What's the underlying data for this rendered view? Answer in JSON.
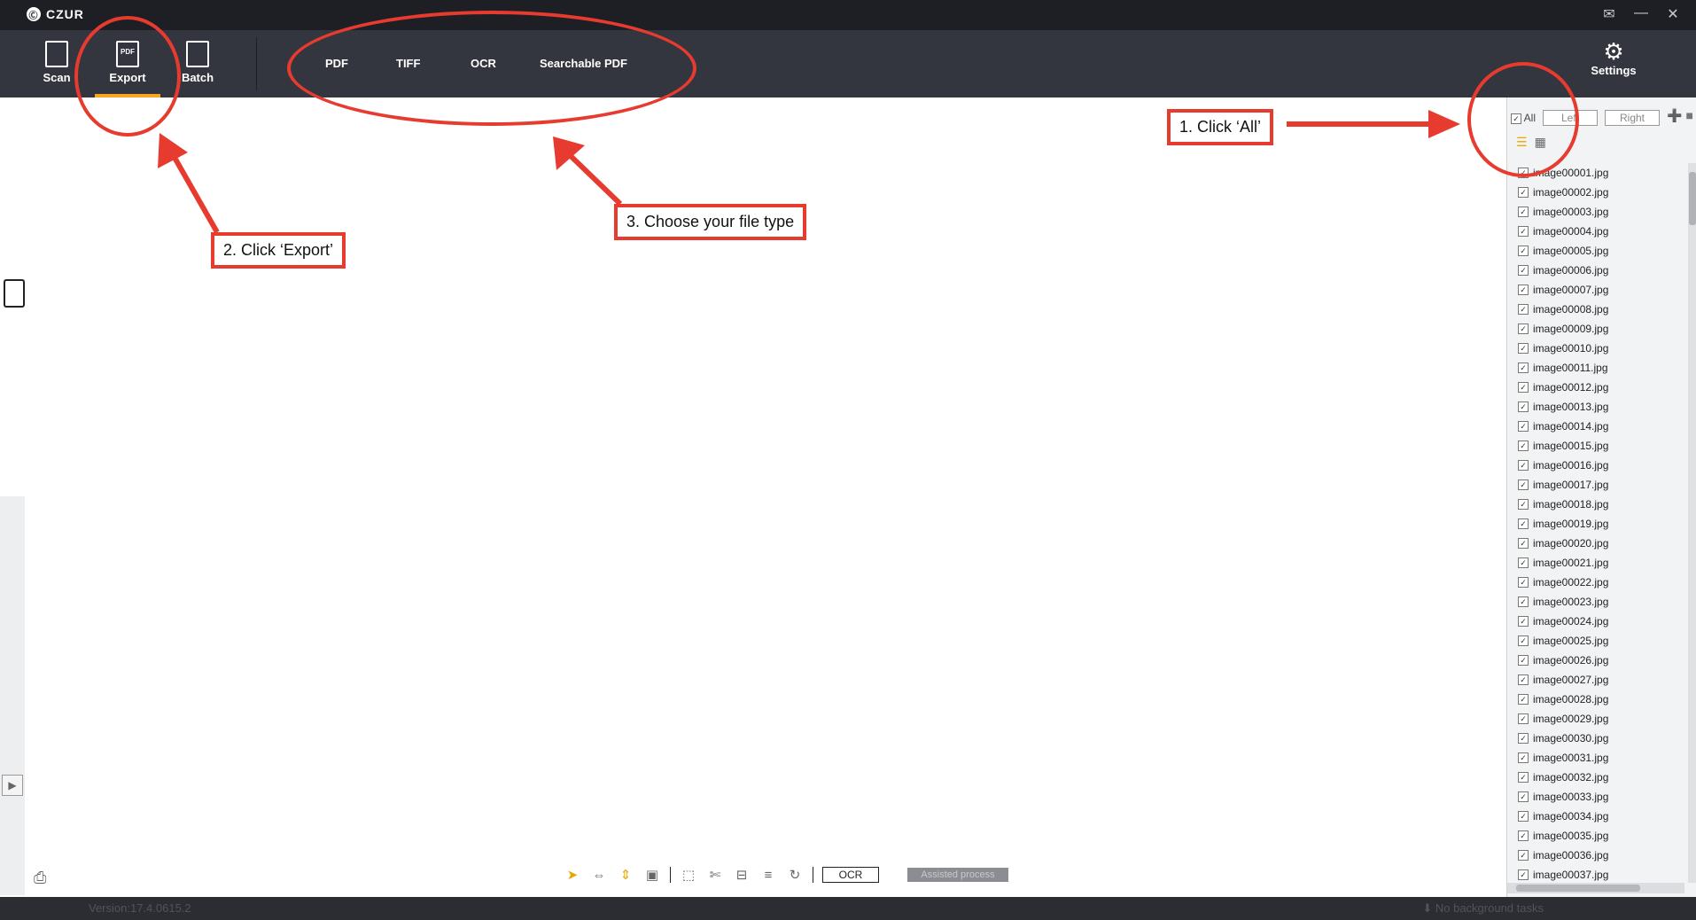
{
  "app": {
    "name": "CZUR",
    "logo_glyph": "Ⓒ"
  },
  "window_controls": {
    "mail": "✉",
    "minimize": "—",
    "close": "✕"
  },
  "toolbar": {
    "scan_label": "Scan",
    "export_label": "Export",
    "export_icon_text": "PDF",
    "batch_label": "Batch",
    "settings_label": "Settings",
    "settings_glyph": "⚙",
    "sub_buttons": [
      "PDF",
      "TIFF",
      "OCR",
      "Searchable PDF"
    ]
  },
  "file_panel": {
    "all_label": "All",
    "left_label": "Left",
    "right_label": "Right",
    "list_view_glyph": "☰",
    "grid_view_glyph": "▦",
    "add_icon_glyph": "➕",
    "folder_icon_glyph": "■",
    "check_glyph": "✓",
    "files": [
      "image00001.jpg",
      "image00002.jpg",
      "image00003.jpg",
      "image00004.jpg",
      "image00005.jpg",
      "image00006.jpg",
      "image00007.jpg",
      "image00008.jpg",
      "image00009.jpg",
      "image00010.jpg",
      "image00011.jpg",
      "image00012.jpg",
      "image00013.jpg",
      "image00014.jpg",
      "image00015.jpg",
      "image00016.jpg",
      "image00017.jpg",
      "image00018.jpg",
      "image00019.jpg",
      "image00020.jpg",
      "image00021.jpg",
      "image00022.jpg",
      "image00023.jpg",
      "image00024.jpg",
      "image00025.jpg",
      "image00026.jpg",
      "image00027.jpg",
      "image00028.jpg",
      "image00029.jpg",
      "image00030.jpg",
      "image00031.jpg",
      "image00032.jpg",
      "image00033.jpg",
      "image00034.jpg",
      "image00035.jpg",
      "image00036.jpg",
      "image00037.jpg"
    ]
  },
  "bottom_toolbar": {
    "ocr_label": "OCR",
    "assisted_label": "Assisted process",
    "print_glyph": "⎙",
    "left_play_glyph": "▶",
    "tool_glyphs": {
      "pointer": "➤",
      "fit_width": "⇔",
      "fit_height": "⇕",
      "actual_size": "▣",
      "select": "⬚",
      "crop": "✄",
      "split": "⊟",
      "adjust": "≡",
      "rotate": "↻"
    }
  },
  "status": {
    "version": "Version:17.4.0615.2",
    "tasks": "⬇ No background tasks"
  },
  "annotations": {
    "step1": "1. Click ‘All’",
    "step2": "2. Click ‘Export’",
    "step3": "3. Choose your file type"
  },
  "colors": {
    "annotation_red": "#e63b2e",
    "active_tab": "#f5a623",
    "toolbar_bg": "#33363f",
    "titlebar_bg": "#1e1f24"
  }
}
